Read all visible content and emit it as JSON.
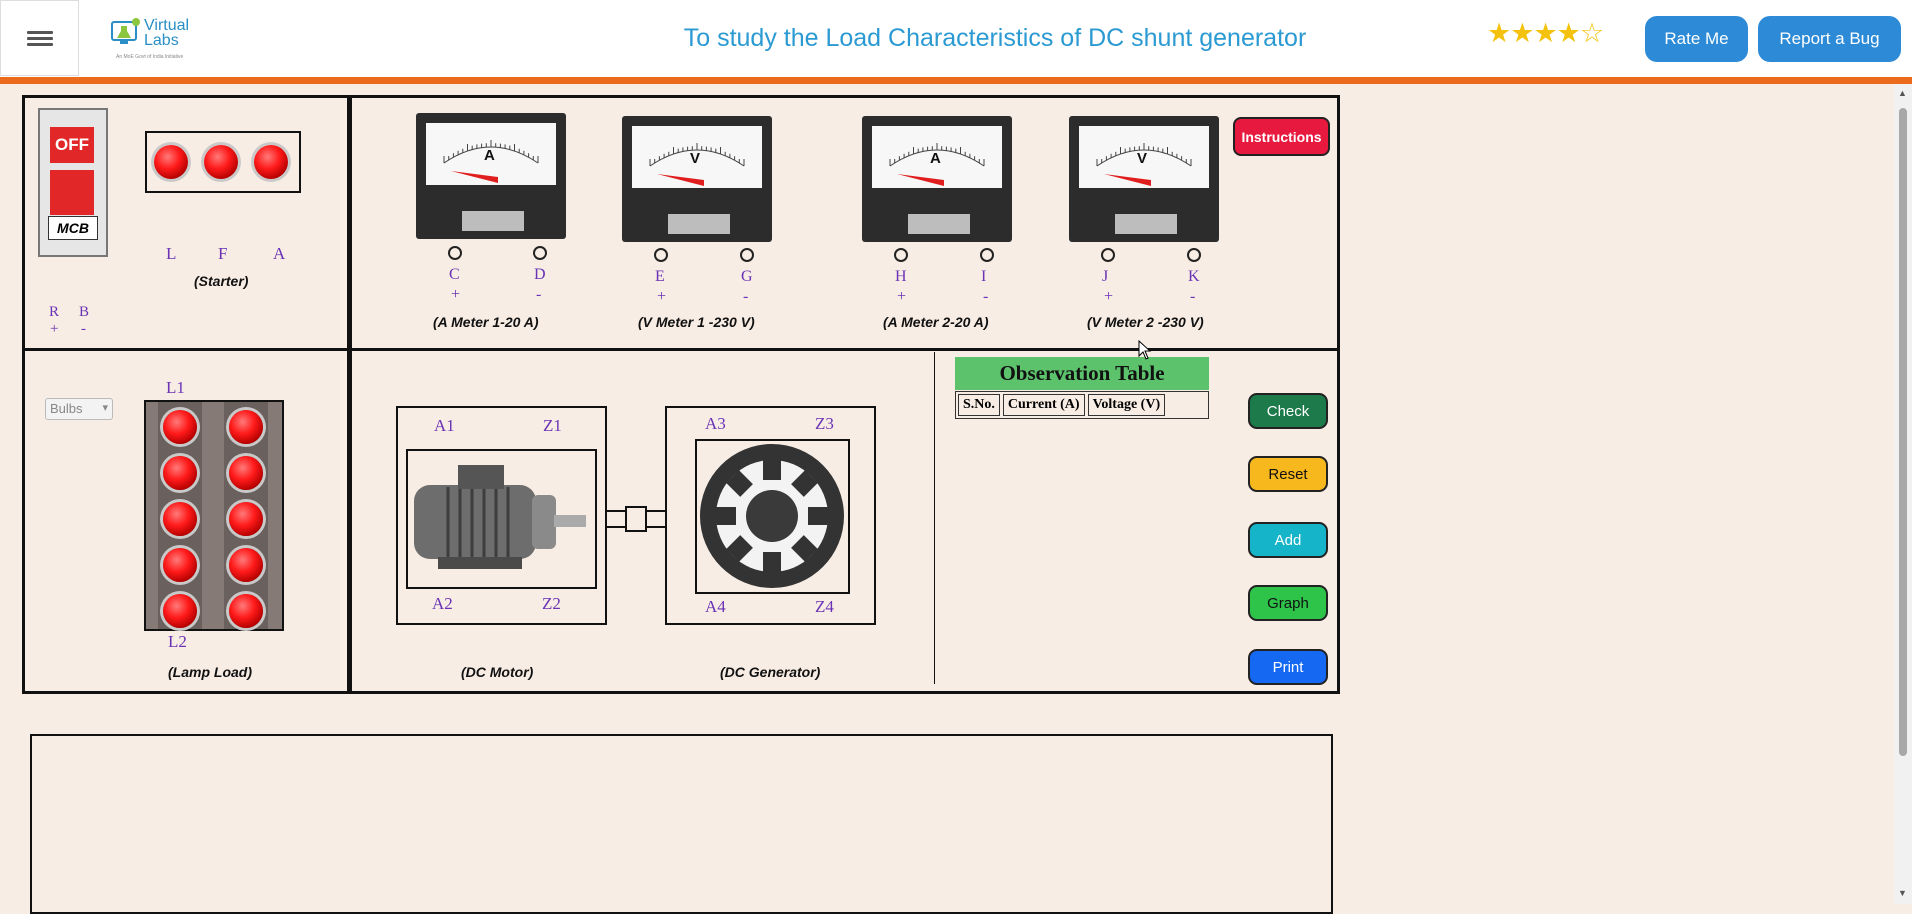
{
  "header": {
    "title": "To study the Load Characteristics of DC shunt generator",
    "logo_name_line1": "Virtual",
    "logo_name_line2": "Labs",
    "logo_tagline": "An MoE Govt of India Initiative",
    "rating_stars": 4,
    "rating_max": 5,
    "rate_label": "Rate Me",
    "bug_label": "Report a Bug"
  },
  "starter": {
    "mcb_state": "OFF",
    "mcb_label": "MCB",
    "terminals": [
      "L",
      "F",
      "A"
    ],
    "caption": "(Starter)",
    "supply_terminals": [
      "R",
      "B"
    ],
    "supply_polarity": [
      "+",
      "-"
    ]
  },
  "meters": [
    {
      "symbol": "A",
      "terminals": [
        "C",
        "D"
      ],
      "polarity": [
        "+",
        "-"
      ],
      "caption": "(A Meter 1-20 A)"
    },
    {
      "symbol": "V",
      "terminals": [
        "E",
        "G"
      ],
      "polarity": [
        "+",
        "-"
      ],
      "caption": "(V Meter 1 -230 V)"
    },
    {
      "symbol": "A",
      "terminals": [
        "H",
        "I"
      ],
      "polarity": [
        "+",
        "-"
      ],
      "caption": "(A Meter 2-20 A)"
    },
    {
      "symbol": "V",
      "terminals": [
        "J",
        "K"
      ],
      "polarity": [
        "+",
        "-"
      ],
      "caption": "(V Meter 2 -230 V)"
    }
  ],
  "instructions_label": "Instructions",
  "lamp_load": {
    "select_value": "Bulbs",
    "top_terminal": "L1",
    "bottom_terminal": "L2",
    "caption": "(Lamp Load)"
  },
  "motor": {
    "terminals_top": [
      "A1",
      "Z1"
    ],
    "terminals_bottom": [
      "A2",
      "Z2"
    ],
    "caption": "(DC Motor)"
  },
  "generator": {
    "terminals_top": [
      "A3",
      "Z3"
    ],
    "terminals_bottom": [
      "A4",
      "Z4"
    ],
    "caption": "(DC Generator)"
  },
  "observation_table": {
    "title": "Observation Table",
    "columns": [
      "S.No.",
      "Current (A)",
      "Voltage (V)"
    ]
  },
  "buttons": {
    "check": "Check",
    "reset": "Reset",
    "add": "Add",
    "graph": "Graph",
    "print": "Print"
  },
  "colors": {
    "accent": "#2c8ad6",
    "header_bar": "#ec6a1c",
    "title": "#2b9ad3",
    "background": "#f8ede4",
    "instructions": "#e8193f",
    "check": "#1d7a4a",
    "reset": "#f6b81c",
    "add": "#16b4c9",
    "graph": "#2ec44a",
    "print": "#1468f2"
  }
}
